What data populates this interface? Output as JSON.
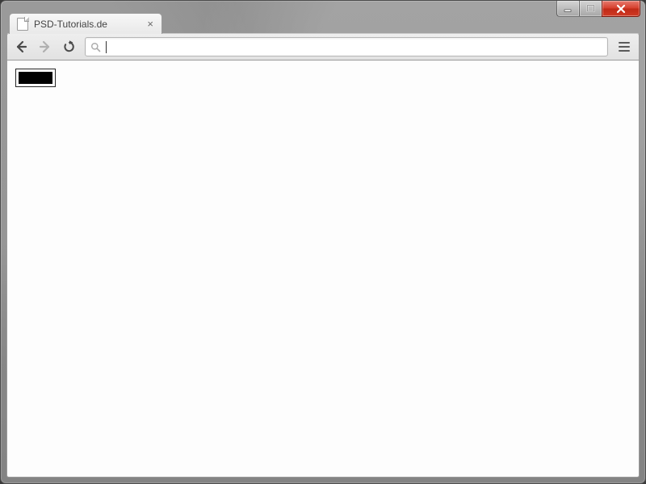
{
  "window": {
    "minimize_icon": "minimize",
    "maximize_icon": "maximize",
    "close_icon": "close"
  },
  "tab": {
    "title": "PSD-Tutorials.de",
    "close_glyph": "×"
  },
  "toolbar": {
    "back_icon": "back",
    "forward_icon": "forward",
    "reload_icon": "reload",
    "search_icon": "search",
    "menu_icon": "menu",
    "url_value": ""
  },
  "page": {
    "canvas_label": "canvas"
  }
}
